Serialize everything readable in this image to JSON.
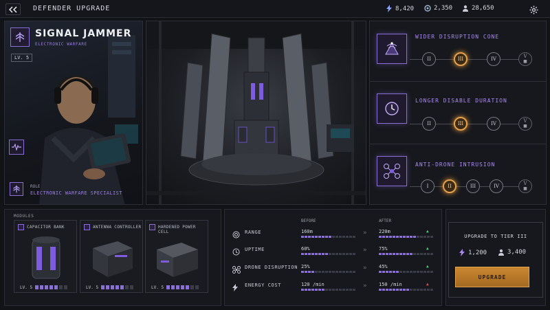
{
  "header": {
    "title": "DEFENDER UPGRADE",
    "resources": [
      {
        "icon": "energy-bolt-icon",
        "value": "8,420"
      },
      {
        "icon": "crystal-icon",
        "value": "2,350"
      },
      {
        "icon": "personnel-icon",
        "value": "28,650"
      }
    ]
  },
  "hero": {
    "name": "SIGNAL JAMMER",
    "subtitle": "ELECTRONIC WARFARE",
    "level": "LV. 5",
    "role_label": "ROLE",
    "role": "ELECTRONIC WARFARE SPECIALIST"
  },
  "upgrades": [
    {
      "title": "WIDER DISRUPTION CONE",
      "icon": "radar-cone-icon",
      "tiers": [
        "II",
        "III",
        "IV",
        "V"
      ],
      "current": 1
    },
    {
      "title": "LONGER DISABLE DURATION",
      "icon": "clock-icon",
      "tiers": [
        "II",
        "III",
        "IV",
        "V"
      ],
      "current": 1
    },
    {
      "title": "ANTI-DRONE INTRUSION",
      "icon": "drone-icon",
      "tiers": [
        "I",
        "II",
        "III",
        "IV",
        "V"
      ],
      "current": 1
    }
  ],
  "modules": {
    "title": "MODULES",
    "items": [
      {
        "name": "CAPACITOR BANK",
        "level": "LV. 5",
        "filled": 5,
        "total": 7
      },
      {
        "name": "ANTENNA CONTROLLER",
        "level": "LV. 5",
        "filled": 5,
        "total": 7
      },
      {
        "name": "HARDENED POWER CELL",
        "level": "LV. 5",
        "filled": 5,
        "total": 7
      }
    ]
  },
  "stats": {
    "before_label": "BEFORE",
    "after_label": "AFTER",
    "rows": [
      {
        "name": "RANGE",
        "icon": "range-icon",
        "before": "160m",
        "after": "220m",
        "before_fill": 0.55,
        "after_fill": 0.7,
        "trend": "up"
      },
      {
        "name": "UPTIME",
        "icon": "uptime-icon",
        "before": "60%",
        "after": "75%",
        "before_fill": 0.5,
        "after_fill": 0.6,
        "trend": "up"
      },
      {
        "name": "DRONE DISRUPTION",
        "icon": "drone-disruption-icon",
        "before": "25%",
        "after": "45%",
        "before_fill": 0.25,
        "after_fill": 0.4,
        "trend": "up"
      },
      {
        "name": "ENERGY COST",
        "icon": "energy-cost-icon",
        "before": "120 /min",
        "after": "150 /min",
        "before_fill": 0.45,
        "after_fill": 0.55,
        "trend": "down"
      }
    ]
  },
  "cost": {
    "title": "UPGRADE TO TIER III",
    "energy": "1,200",
    "personnel": "3,400",
    "button": "UPGRADE"
  },
  "colors": {
    "accent": "#8a6fd6",
    "highlight": "#e4a14a",
    "positive": "#4ccf78",
    "negative": "#e05050"
  }
}
